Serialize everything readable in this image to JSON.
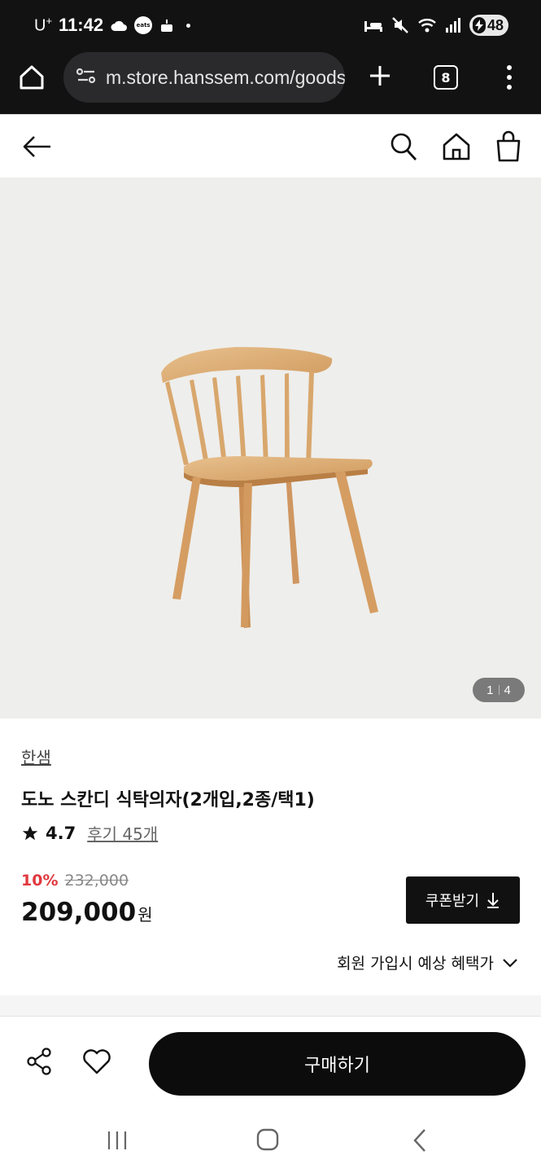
{
  "status_bar": {
    "carrier": "U",
    "carrier_sup": "+",
    "time": "11:42",
    "app_badge": "eats",
    "battery": "48"
  },
  "browser": {
    "url": "m.store.hanssem.com/goods",
    "tab_count": "8"
  },
  "product": {
    "image_counter_current": "1",
    "image_counter_total": "4",
    "brand": "한샘",
    "name": "도노 스칸디 식탁의자(2개입,2종/택1)",
    "rating": "4.7",
    "reviews_label": "후기 45개",
    "discount": "10%",
    "original_price": "232,000",
    "final_price": "209,000",
    "currency": "원",
    "coupon_label": "쿠폰받기",
    "benefit_label": "회원 가입시 예상 혜택가"
  },
  "actions": {
    "buy_label": "구매하기"
  },
  "colors": {
    "discount_red": "#e0393e",
    "button_black": "#111111",
    "image_bg": "#eeeeec"
  }
}
